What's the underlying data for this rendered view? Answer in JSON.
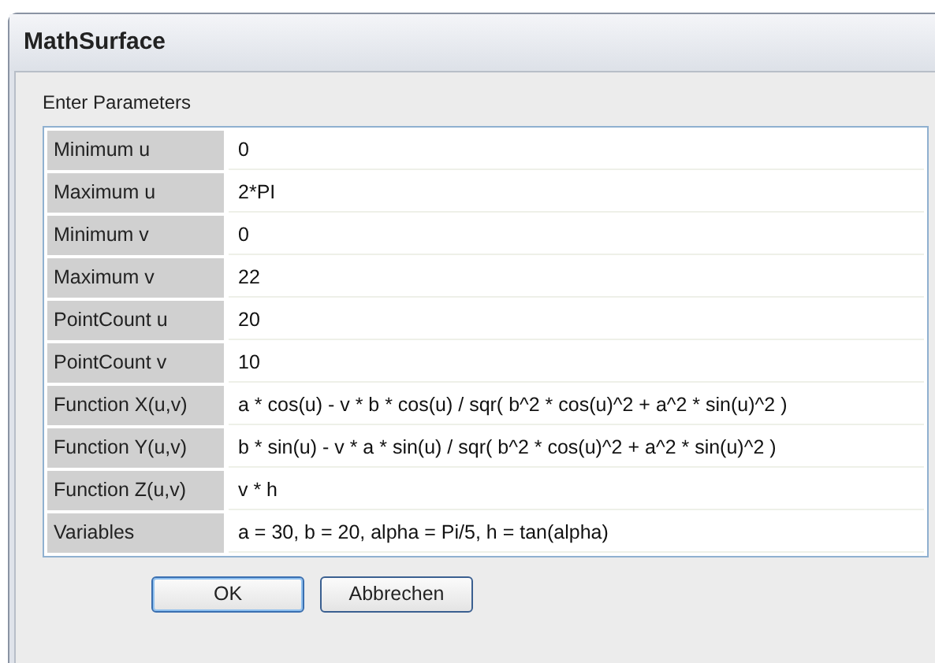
{
  "window": {
    "title": "MathSurface"
  },
  "group": {
    "label": "Enter Parameters"
  },
  "parameters": [
    {
      "name": "Minimum u",
      "value": "0"
    },
    {
      "name": "Maximum u",
      "value": "2*PI"
    },
    {
      "name": "Minimum v",
      "value": "0"
    },
    {
      "name": "Maximum v",
      "value": "22"
    },
    {
      "name": "PointCount u",
      "value": "20"
    },
    {
      "name": "PointCount v",
      "value": "10"
    },
    {
      "name": "Function X(u,v)",
      "value": "a * cos(u) - v * b * cos(u) / sqr( b^2 * cos(u)^2 + a^2 * sin(u)^2 )"
    },
    {
      "name": "Function Y(u,v)",
      "value": "b * sin(u) - v * a * sin(u) / sqr( b^2 * cos(u)^2 + a^2 * sin(u)^2 )"
    },
    {
      "name": "Function Z(u,v)",
      "value": "v * h"
    },
    {
      "name": "Variables",
      "value": "a = 30, b = 20, alpha = Pi/5, h = tan(alpha)"
    }
  ],
  "buttons": [
    {
      "label": "OK",
      "default": true
    },
    {
      "label": "Abbrechen",
      "default": false
    }
  ]
}
